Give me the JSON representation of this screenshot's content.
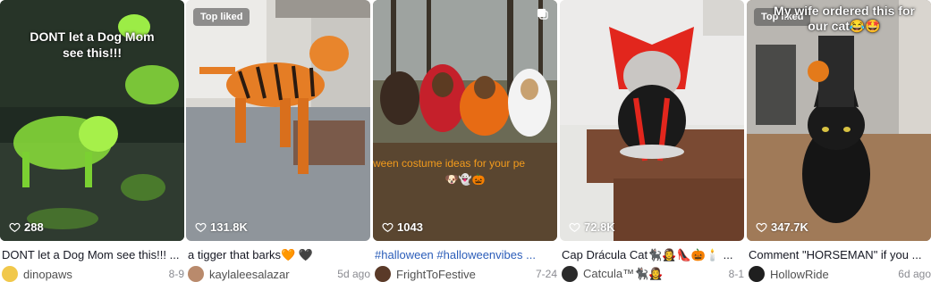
{
  "cards": [
    {
      "overlay": "DONT let a Dog Mom see this!!!",
      "views": "288",
      "caption": "DONT let a Dog Mom see this!!! ...",
      "author": "dinopaws",
      "date": "8-9"
    },
    {
      "badge": "Top liked",
      "views": "131.8K",
      "caption": "a tigger that barks🧡 🖤",
      "author": "kaylaleesalazar",
      "date": "5d ago"
    },
    {
      "overlay": "ween costume ideas for your pe",
      "overlay_emoji": "🐶👻🎃",
      "views": "1043",
      "caption_tags": "#halloween #halloweenvibes ...",
      "author": "FrightToFestive",
      "date": "7-24"
    },
    {
      "views": "72.8K",
      "caption": "Cap Drácula Cat🐈‍⬛🧛‍♀️👠🎃🕯️ ...",
      "author": "Catcula™🐈‍⬛🧛‍♀️",
      "date": "8-1"
    },
    {
      "badge": "Top liked",
      "overlay": "My wife ordered this for our cat😂🤩",
      "views": "347.7K",
      "caption": "Comment \"HORSEMAN\" if you ...",
      "author": "HollowRide",
      "date": "6d ago"
    }
  ],
  "icons": {
    "views": "heart-outline-icon",
    "multi": "photo-carousel-icon"
  }
}
